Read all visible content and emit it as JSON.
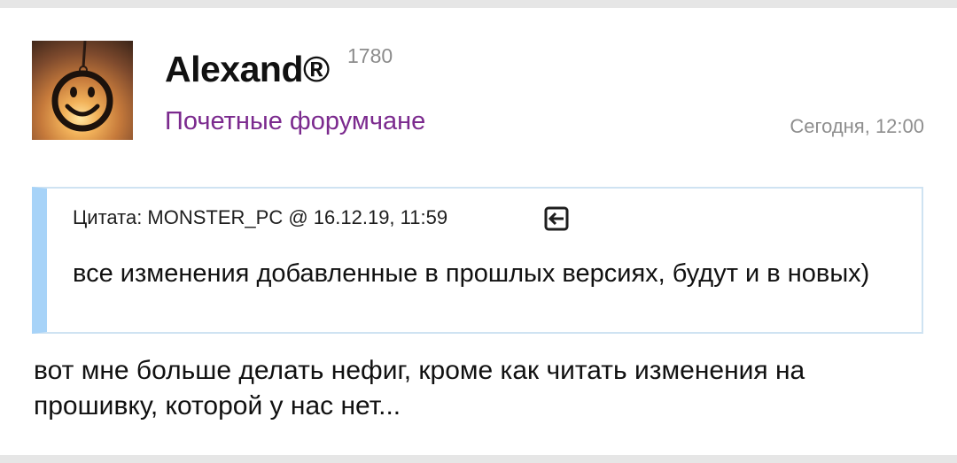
{
  "post": {
    "author": "Alexand®",
    "reputation": "1780",
    "group": "Почетные форумчане",
    "time": "Сегодня, 12:00",
    "quote": {
      "header": "Цитата: MONSTER_PC @ 16.12.19, 11:59",
      "text": "все изменения добавленные в прошлых версиях, будут и в новых)",
      "jump_icon": "jump-to-quote-icon"
    },
    "text": "вот мне больше делать нефиг, кроме как читать изменения на прошивку, которой у нас нет..."
  },
  "colors": {
    "group": "#7b2a8e",
    "quote_bar": "#a7d3f8",
    "quote_border": "#cfe3f2",
    "meta": "#8e8e8e"
  }
}
